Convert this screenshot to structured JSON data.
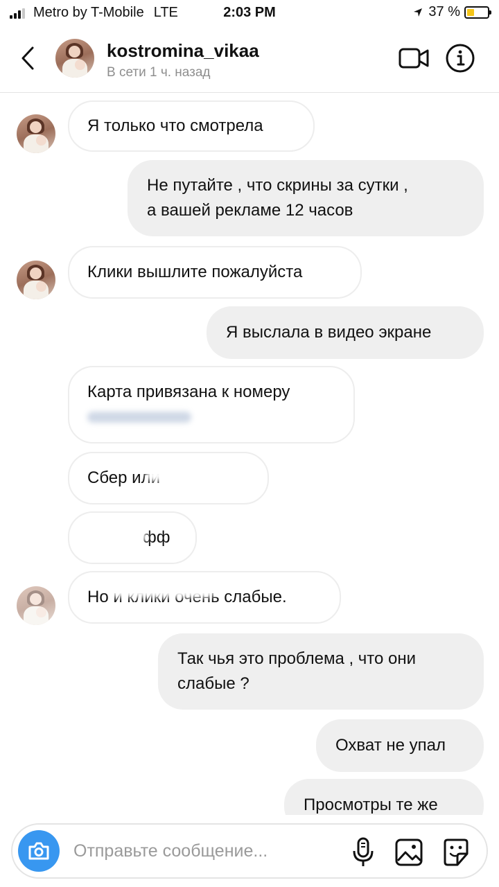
{
  "status_bar": {
    "carrier": "Metro by T-Mobile",
    "network": "LTE",
    "time": "2:03 PM",
    "battery": "37 %",
    "battery_level": 0.37,
    "icons": [
      "signal-icon",
      "location-icon",
      "battery-icon"
    ]
  },
  "header": {
    "username": "kostromina_vikaa",
    "status": "В сети 1 ч. назад",
    "icons": [
      "back-icon",
      "avatar",
      "video-call-icon",
      "info-icon"
    ]
  },
  "messages": [
    {
      "side": "in",
      "lines": [
        "Я только что смотрела"
      ]
    },
    {
      "side": "out",
      "lines": [
        "Не путайте , что скрины за сутки ,",
        "а вашей рекламе 12 часов"
      ]
    },
    {
      "side": "in",
      "lines": [
        "Клики вышлите пожалуйста"
      ]
    },
    {
      "side": "out",
      "lines": [
        "Я выслала в видео экране"
      ]
    },
    {
      "side": "in",
      "lines": [
        "Карта привязана к номеру"
      ],
      "redacted": true
    },
    {
      "side": "in",
      "lines": [
        "Сбер или"
      ],
      "redacted": true
    },
    {
      "side": "in",
      "lines": [
        "фф"
      ],
      "redacted": true
    },
    {
      "side": "in",
      "lines": [
        "Но и клики очень слабые."
      ],
      "redacted": true
    },
    {
      "side": "out",
      "lines": [
        "Так чья это проблема , что они",
        "слабые ?"
      ]
    },
    {
      "side": "out",
      "lines": [
        "Охват не упал"
      ]
    },
    {
      "side": "out",
      "lines": [
        "Просмотры те же"
      ]
    }
  ],
  "composer": {
    "placeholder": "Отправьте сообщение...",
    "icons": [
      "camera-icon",
      "microphone-icon",
      "gallery-icon",
      "sticker-icon"
    ]
  },
  "colors": {
    "accent_blue": "#3897f0",
    "incoming_border": "#ededed",
    "outgoing_bg": "#efefef",
    "muted_text": "#8e8e8e",
    "battery": "#f5c518"
  }
}
